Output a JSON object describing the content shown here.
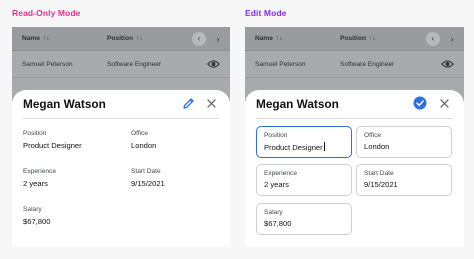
{
  "headings": {
    "read_only": "Read-Only Mode",
    "edit": "Edit Mode"
  },
  "table": {
    "columns": [
      {
        "label": "Name",
        "sort_icon": "↑↓"
      },
      {
        "label": "Position",
        "sort_icon": "↑↓"
      }
    ],
    "rows": [
      {
        "name": "Samuel Peterson",
        "position": "Software Engineer"
      }
    ],
    "icons": {
      "prev": "chevron-left-icon",
      "next": "chevron-right-icon",
      "view": "eye-icon"
    }
  },
  "detail": {
    "name": "Megan Watson",
    "fields": {
      "position": {
        "label": "Position",
        "value": "Product Designer"
      },
      "office": {
        "label": "Office",
        "value": "London"
      },
      "experience": {
        "label": "Experience",
        "value": "2 years"
      },
      "start_date": {
        "label": "Start Date",
        "value": "9/15/2021"
      },
      "salary": {
        "label": "Salary",
        "value": "$67,800"
      }
    }
  },
  "colors": {
    "read_only_heading": "#e0318f",
    "edit_heading": "#8a2be2",
    "accent": "#2f6fde",
    "overlay": "#a9aaad"
  }
}
